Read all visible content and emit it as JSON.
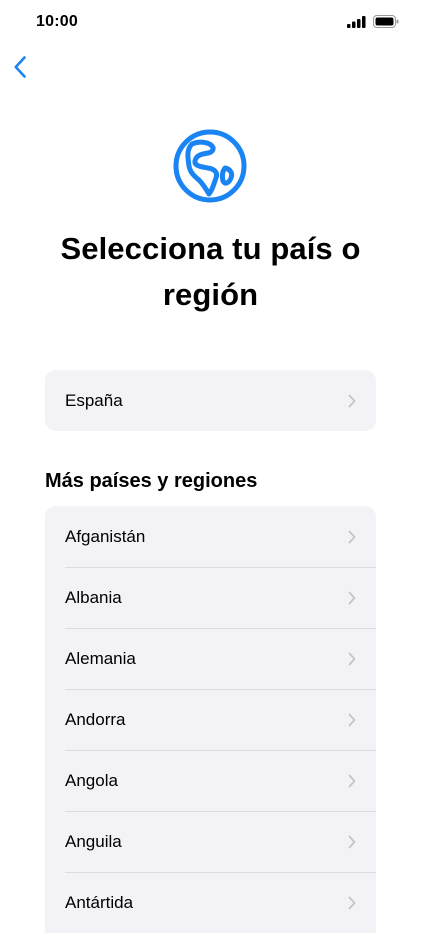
{
  "status_bar": {
    "time": "10:00",
    "icons": [
      "signal-icon",
      "battery-icon"
    ]
  },
  "nav": {
    "back_icon": "chevron-left-icon"
  },
  "header": {
    "icon": "globe-icon",
    "title": "Selecciona tu país o región"
  },
  "current": {
    "label": "España"
  },
  "more_section": {
    "title": "Más países y regiones",
    "items": [
      {
        "label": "Afganistán"
      },
      {
        "label": "Albania"
      },
      {
        "label": "Alemania"
      },
      {
        "label": "Andorra"
      },
      {
        "label": "Angola"
      },
      {
        "label": "Anguila"
      },
      {
        "label": "Antártida"
      }
    ]
  },
  "colors": {
    "accent": "#1a84f2",
    "card_bg": "#f2f2f7",
    "chevron": "#c4c4c9"
  }
}
